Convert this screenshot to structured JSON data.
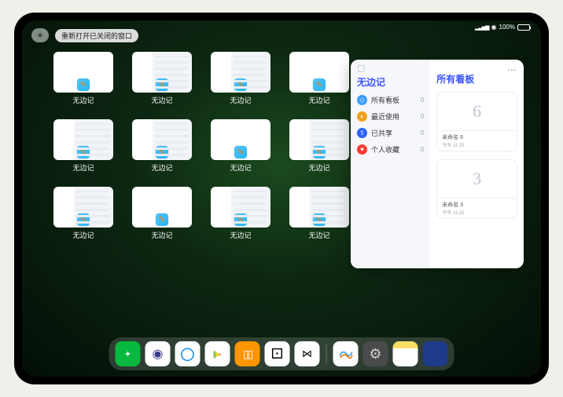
{
  "status": {
    "battery_label": "100%"
  },
  "topbar": {
    "plus_label": "+",
    "reopen_label": "重新打开已关闭的窗口"
  },
  "windows": [
    {
      "label": "无边记",
      "variant": "blank"
    },
    {
      "label": "无边记",
      "variant": "split"
    },
    {
      "label": "无边记",
      "variant": "split"
    },
    {
      "label": "无边记",
      "variant": "blank"
    },
    {
      "label": "无边记",
      "variant": "split"
    },
    {
      "label": "无边记",
      "variant": "split"
    },
    {
      "label": "无边记",
      "variant": "blank"
    },
    {
      "label": "无边记",
      "variant": "split"
    },
    {
      "label": "无边记",
      "variant": "split"
    },
    {
      "label": "无边记",
      "variant": "blank"
    },
    {
      "label": "无边记",
      "variant": "split"
    },
    {
      "label": "无边记",
      "variant": "split"
    }
  ],
  "panel": {
    "left_title": "无边记",
    "nav": [
      {
        "icon": "all",
        "label": "所有看板",
        "count": "0"
      },
      {
        "icon": "recent",
        "label": "最近使用",
        "count": "0"
      },
      {
        "icon": "shared",
        "label": "已共享",
        "count": "0"
      },
      {
        "icon": "fav",
        "label": "个人收藏",
        "count": "0"
      }
    ],
    "right_title": "所有看板",
    "boards": [
      {
        "glyph": "6",
        "name": "未命名 6",
        "time": "今天 11:25"
      },
      {
        "glyph": "3",
        "name": "未命名 3",
        "time": "今天 11:25"
      }
    ]
  },
  "dock": {
    "main": [
      {
        "name": "wechat",
        "class": "d-wechat"
      },
      {
        "name": "quark",
        "class": "d-quark"
      },
      {
        "name": "qqbrowser",
        "class": "d-qqb"
      },
      {
        "name": "video",
        "class": "d-video"
      },
      {
        "name": "books",
        "class": "d-books"
      },
      {
        "name": "dice-app",
        "class": "d-dice"
      },
      {
        "name": "nodes-app",
        "class": "d-node"
      }
    ],
    "recent": [
      {
        "name": "freeform",
        "class": "d-freeform"
      },
      {
        "name": "settings",
        "class": "d-settings"
      },
      {
        "name": "notes",
        "class": "d-notes"
      },
      {
        "name": "app-library",
        "class": "d-library"
      }
    ]
  }
}
